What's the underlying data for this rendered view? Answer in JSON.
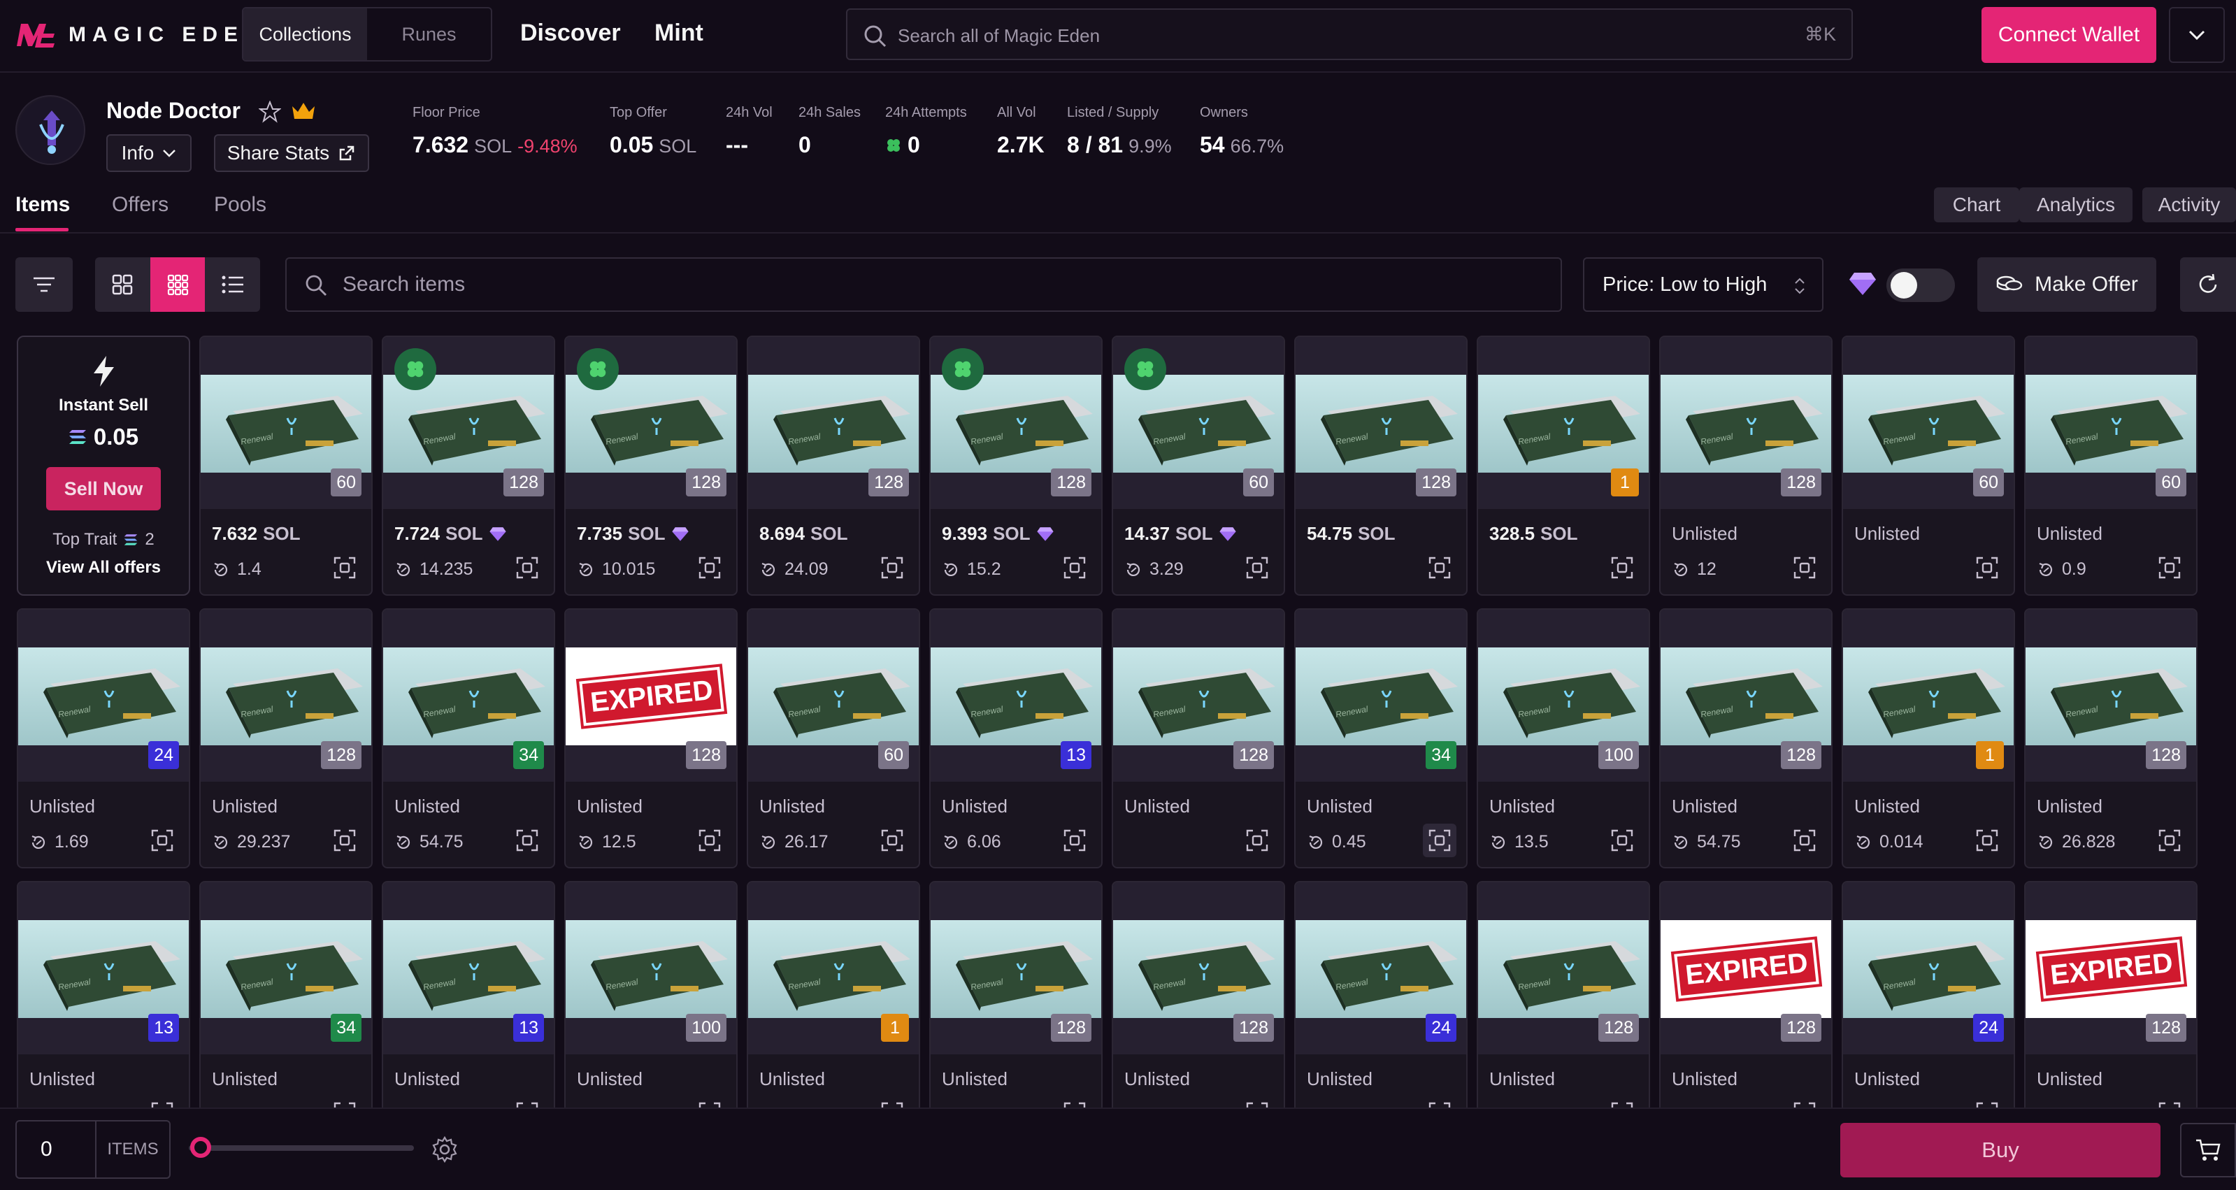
{
  "header": {
    "brand": "MAGIC EDEN",
    "segment": [
      "Collections",
      "Runes"
    ],
    "nav": [
      "Discover",
      "Mint"
    ],
    "search_placeholder": "Search all of Magic Eden",
    "search_shortcut": "⌘K",
    "connect_label": "Connect Wallet"
  },
  "collection": {
    "name": "Node Doctor",
    "info_label": "Info",
    "share_label": "Share Stats",
    "stats": {
      "floor": {
        "label": "Floor Price",
        "value": "7.632",
        "unit": "SOL",
        "change": "-9.48%"
      },
      "top_offer": {
        "label": "Top Offer",
        "value": "0.05",
        "unit": "SOL"
      },
      "vol24": {
        "label": "24h Vol",
        "value": "---"
      },
      "sales24": {
        "label": "24h Sales",
        "value": "0"
      },
      "attempts24": {
        "label": "24h Attempts",
        "value": "0"
      },
      "all_vol": {
        "label": "All Vol",
        "value": "2.7K"
      },
      "listed": {
        "label": "Listed / Supply",
        "value": "8 / 81",
        "pct": "9.9%"
      },
      "owners": {
        "label": "Owners",
        "value": "54",
        "pct": "66.7%"
      }
    }
  },
  "tabs": [
    "Items",
    "Offers",
    "Pools"
  ],
  "right_tabs": [
    "Chart",
    "Analytics",
    "Activity"
  ],
  "toolbar": {
    "search_placeholder": "Search items",
    "sort_label": "Price: Low to High",
    "make_offer_label": "Make Offer"
  },
  "instant_sell": {
    "title": "Instant Sell",
    "value": "0.05",
    "button": "Sell Now",
    "top_trait_label": "Top Trait",
    "top_trait_count": "2",
    "view_all": "View All offers"
  },
  "colors": {
    "accent": "#e42575",
    "badge_grey": "#7b7488",
    "badge_blue": "#3a2fd8",
    "badge_green": "#1f8a4a",
    "badge_orange": "#e08a12"
  },
  "rows": [
    [
      {
        "badge": "60",
        "badge_color": "grey",
        "price": "7.632",
        "unit": "SOL",
        "last": "1.4"
      },
      {
        "badge": "128",
        "badge_color": "grey",
        "price": "7.724",
        "unit": "SOL",
        "diamond": true,
        "clover": true,
        "last": "14.235"
      },
      {
        "badge": "128",
        "badge_color": "grey",
        "price": "7.735",
        "unit": "SOL",
        "diamond": true,
        "clover": true,
        "last": "10.015"
      },
      {
        "badge": "128",
        "badge_color": "grey",
        "price": "8.694",
        "unit": "SOL",
        "last": "24.09"
      },
      {
        "badge": "128",
        "badge_color": "grey",
        "price": "9.393",
        "unit": "SOL",
        "diamond": true,
        "clover": true,
        "last": "15.2"
      },
      {
        "badge": "60",
        "badge_color": "grey",
        "price": "14.37",
        "unit": "SOL",
        "diamond": true,
        "clover": true,
        "last": "3.29"
      },
      {
        "badge": "128",
        "badge_color": "grey",
        "price": "54.75",
        "unit": "SOL",
        "last": ""
      },
      {
        "badge": "1",
        "badge_color": "orange",
        "price": "328.5",
        "unit": "SOL",
        "last": ""
      },
      {
        "badge": "128",
        "badge_color": "grey",
        "status": "Unlisted",
        "last": "12"
      },
      {
        "badge": "60",
        "badge_color": "grey",
        "status": "Unlisted",
        "last": ""
      },
      {
        "badge": "60",
        "badge_color": "grey",
        "status": "Unlisted",
        "last": "0.9"
      }
    ],
    [
      {
        "badge": "24",
        "badge_color": "blue",
        "status": "Unlisted",
        "last": "1.69"
      },
      {
        "badge": "128",
        "badge_color": "grey",
        "status": "Unlisted",
        "last": "29.237"
      },
      {
        "badge": "34",
        "badge_color": "green",
        "status": "Unlisted",
        "last": "54.75"
      },
      {
        "badge": "128",
        "badge_color": "grey",
        "status": "Unlisted",
        "last": "12.5",
        "expired": true
      },
      {
        "badge": "60",
        "badge_color": "grey",
        "status": "Unlisted",
        "last": "26.17"
      },
      {
        "badge": "13",
        "badge_color": "blue",
        "status": "Unlisted",
        "last": "6.06"
      },
      {
        "badge": "128",
        "badge_color": "grey",
        "status": "Unlisted",
        "last": ""
      },
      {
        "badge": "34",
        "badge_color": "green",
        "status": "Unlisted",
        "last": "0.45",
        "highlight": true
      },
      {
        "badge": "100",
        "badge_color": "grey",
        "status": "Unlisted",
        "last": "13.5"
      },
      {
        "badge": "128",
        "badge_color": "grey",
        "status": "Unlisted",
        "last": "54.75"
      },
      {
        "badge": "1",
        "badge_color": "orange",
        "status": "Unlisted",
        "last": "0.014"
      },
      {
        "badge": "128",
        "badge_color": "grey",
        "status": "Unlisted",
        "last": "26.828"
      }
    ],
    [
      {
        "badge": "13",
        "badge_color": "blue",
        "status": "Unlisted",
        "last": ""
      },
      {
        "badge": "34",
        "badge_color": "green",
        "status": "Unlisted",
        "last": ""
      },
      {
        "badge": "13",
        "badge_color": "blue",
        "status": "Unlisted",
        "last": ""
      },
      {
        "badge": "100",
        "badge_color": "grey",
        "status": "Unlisted",
        "last": ""
      },
      {
        "badge": "1",
        "badge_color": "orange",
        "status": "Unlisted",
        "last": ""
      },
      {
        "badge": "128",
        "badge_color": "grey",
        "status": "Unlisted",
        "last": ""
      },
      {
        "badge": "128",
        "badge_color": "grey",
        "status": "Unlisted",
        "last": ""
      },
      {
        "badge": "24",
        "badge_color": "blue",
        "status": "Unlisted",
        "last": ""
      },
      {
        "badge": "128",
        "badge_color": "grey",
        "status": "Unlisted",
        "last": ""
      },
      {
        "badge": "128",
        "badge_color": "grey",
        "status": "Unlisted",
        "last": "",
        "expired": true
      },
      {
        "badge": "24",
        "badge_color": "blue",
        "status": "Unlisted",
        "last": ""
      },
      {
        "badge": "128",
        "badge_color": "grey",
        "status": "Unlisted",
        "last": "",
        "expired": true
      }
    ]
  ],
  "expired_label": "EXPIRED",
  "card_art_text": "Renewal",
  "bottom": {
    "qty_value": "0",
    "qty_unit": "ITEMS",
    "buy_label": "Buy"
  }
}
